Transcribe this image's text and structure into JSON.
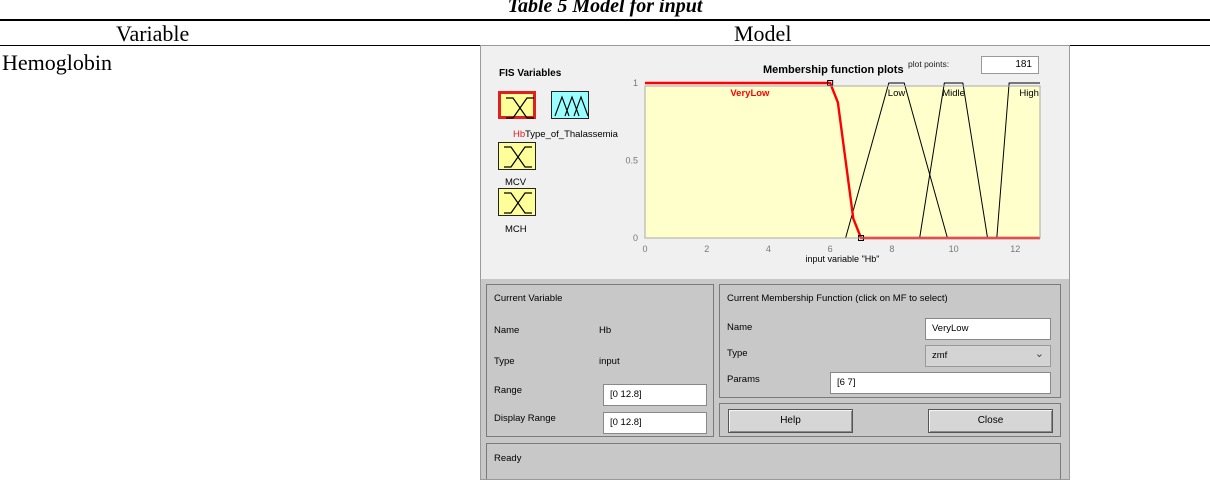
{
  "caption": "Table 5 Model for input",
  "table": {
    "headers": [
      "Variable",
      "Model"
    ],
    "rows": [
      {
        "variable": "Hemoglobin"
      }
    ]
  },
  "fis": {
    "variables_title": "FIS Variables",
    "plot_title": "Membership function plots",
    "plot_points_label": "plot points:",
    "plot_points_value": "181",
    "variables": [
      {
        "name": "Hb",
        "kind": "input",
        "selected": true
      },
      {
        "name": "Type_of_Thalassemia",
        "kind": "output",
        "selected": false
      },
      {
        "name": "MCV",
        "kind": "input",
        "selected": false
      },
      {
        "name": "MCH",
        "kind": "input",
        "selected": false
      }
    ],
    "label_hb": "Hb",
    "label_output": "Type_of_Thalassemia",
    "label_mcv": "MCV",
    "label_mch": "MCH",
    "chart_data": {
      "type": "line",
      "xlabel": "input variable \"Hb\"",
      "xlim": [
        0,
        12.8
      ],
      "ylim": [
        0,
        1
      ],
      "xticks": [
        0,
        2,
        4,
        6,
        8,
        10,
        12
      ],
      "yticks": [
        0,
        0.5,
        1
      ],
      "series": [
        {
          "name": "VeryLow",
          "kind": "zmf",
          "selected": true,
          "x": [
            0,
            6,
            6.25,
            6.5,
            6.75,
            7,
            12.8
          ],
          "y": [
            1,
            1,
            0.875,
            0.5,
            0.125,
            0,
            0
          ]
        },
        {
          "name": "Low",
          "kind": "trapmf",
          "selected": false,
          "x": [
            0,
            6.5,
            7.9,
            8.4,
            9.8,
            12.8
          ],
          "y": [
            0,
            0,
            1,
            1,
            0,
            0
          ]
        },
        {
          "name": "Midle",
          "kind": "trapmf",
          "selected": false,
          "x": [
            0,
            8.9,
            9.7,
            10.3,
            11.1,
            12.8
          ],
          "y": [
            0,
            0,
            1,
            1,
            0,
            0
          ]
        },
        {
          "name": "High",
          "kind": "trapmf",
          "selected": false,
          "x": [
            0,
            11.4,
            11.8,
            12.8
          ],
          "y": [
            0,
            0,
            1,
            1
          ]
        }
      ],
      "colors": {
        "plot_bg": "#ffffcc",
        "selected": "#ff0000",
        "default": "#000000"
      }
    },
    "current_variable": {
      "title": "Current Variable",
      "name_label": "Name",
      "name_value": "Hb",
      "type_label": "Type",
      "type_value": "input",
      "range_label": "Range",
      "range_value": "[0 12.8]",
      "display_range_label": "Display Range",
      "display_range_value": "[0 12.8]"
    },
    "current_mf": {
      "title": "Current Membership Function (click on MF to select)",
      "name_label": "Name",
      "name_value": "VeryLow",
      "type_label": "Type",
      "type_value": "zmf",
      "params_label": "Params",
      "params_value": "[6 7]"
    },
    "buttons": {
      "help": "Help",
      "close": "Close"
    },
    "status": "Ready"
  }
}
